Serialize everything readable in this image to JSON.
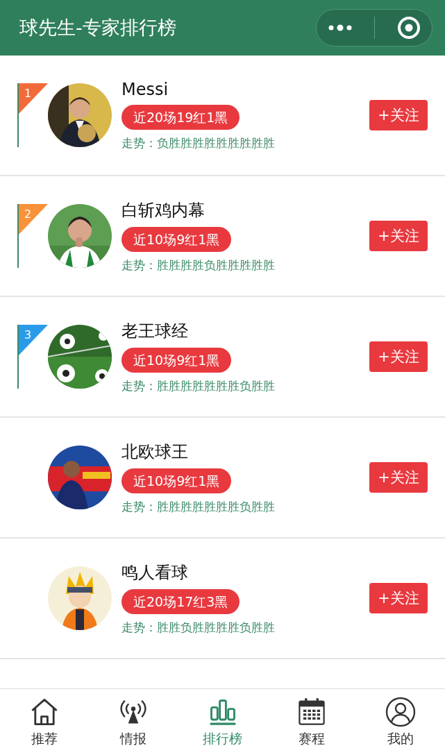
{
  "header": {
    "title": "球先生-专家排行榜"
  },
  "experts": [
    {
      "rank": "1",
      "color": "#f26a3a",
      "name": "Messi",
      "record": "近20场19红1黑",
      "trend": "走势：负胜胜胜胜胜胜胜胜胜",
      "follow": "+关注"
    },
    {
      "rank": "2",
      "color": "#f7923a",
      "name": "白斩鸡内幕",
      "record": "近10场9红1黑",
      "trend": "走势：胜胜胜胜负胜胜胜胜胜",
      "follow": "+关注"
    },
    {
      "rank": "3",
      "color": "#2a9be8",
      "name": "老王球经",
      "record": "近10场9红1黑",
      "trend": "走势：胜胜胜胜胜胜胜负胜胜",
      "follow": "+关注"
    },
    {
      "name": "北欧球王",
      "record": "近10场9红1黑",
      "trend": "走势：胜胜胜胜胜胜胜负胜胜",
      "follow": "+关注"
    },
    {
      "name": "鸣人看球",
      "record": "近20场17红3黑",
      "trend": "走势：胜胜负胜胜胜胜负胜胜",
      "follow": "+关注"
    }
  ],
  "tabs": [
    {
      "kind": "home",
      "label": "推荐",
      "selected": false
    },
    {
      "kind": "signal",
      "label": "情报",
      "selected": false
    },
    {
      "kind": "chart",
      "label": "排行榜",
      "selected": true
    },
    {
      "kind": "calendar",
      "label": "赛程",
      "selected": false
    },
    {
      "kind": "user",
      "label": "我的",
      "selected": false
    }
  ]
}
